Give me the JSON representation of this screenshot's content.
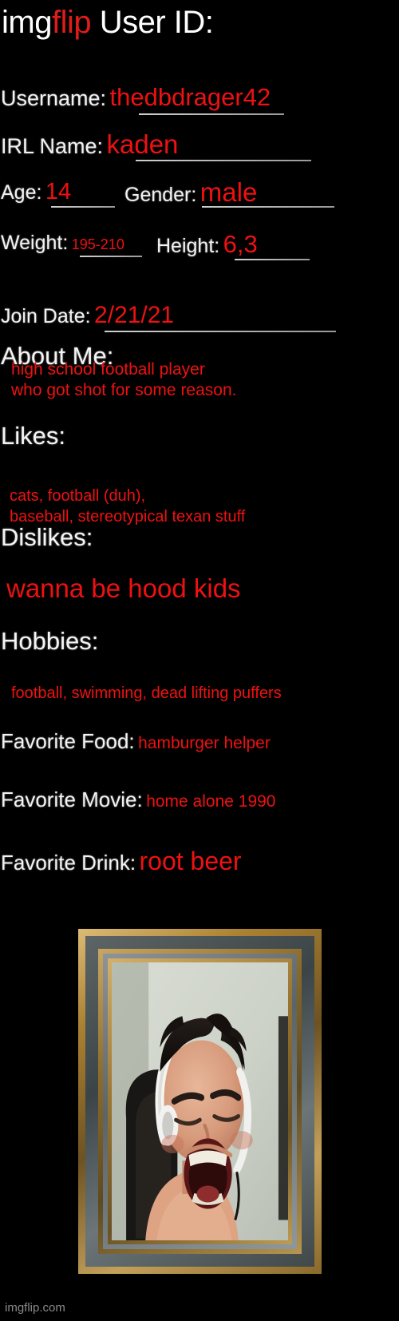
{
  "header": {
    "brand_img": "img",
    "brand_flip": "flip",
    "title": "User ID:"
  },
  "colors": {
    "background": "#000000",
    "label": "#f2f2f2",
    "value": "#ef1111",
    "brand_accent": "#e01b1b",
    "rule": "#cfcfcf",
    "watermark": "#8a8a8a"
  },
  "fields": {
    "username_label": "Username:",
    "username_value": "thedbdrager42",
    "irl_name_label": "IRL Name:",
    "irl_name_value": "kaden",
    "age_label": "Age:",
    "age_value": "14",
    "gender_label": "Gender:",
    "gender_value": "male",
    "weight_label": "Weight:",
    "weight_value": "195-210",
    "height_label": "Height:",
    "height_value": "6,3",
    "join_date_label": "Join Date:",
    "join_date_value": "2/21/21"
  },
  "sections": {
    "about_heading": "About Me:",
    "about_text": "high school football player\nwho got shot for some reason.",
    "likes_heading": "Likes:",
    "likes_text": "cats, football (duh),\nbaseball, stereotypical texan stuff",
    "dislikes_heading": "Dislikes:",
    "dislikes_text": "wanna be hood kids",
    "hobbies_heading": "Hobbies:",
    "hobbies_text": "football, swimming, dead lifting puffers"
  },
  "favorites": {
    "food_label": "Favorite Food:",
    "food_value": "hamburger helper",
    "movie_label": "Favorite Movie:",
    "movie_value": "home alone 1990",
    "drink_label": "Favorite Drink:",
    "drink_value": "root beer"
  },
  "photo": {
    "description": "framed webcam photo of a screaming person wearing white headphones"
  },
  "watermark": "imgflip.com"
}
